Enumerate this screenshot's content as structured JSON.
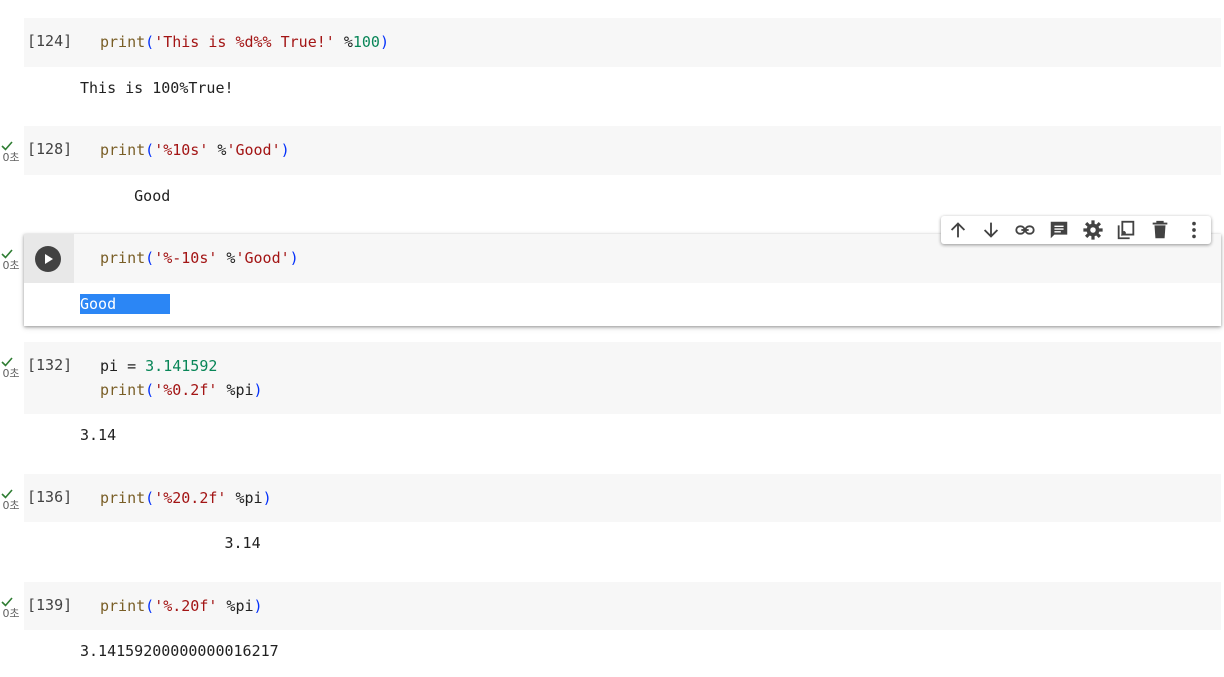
{
  "cells": [
    {
      "count": "[124]",
      "output": "This is 100%True!",
      "status": ""
    },
    {
      "count": "[128]",
      "output": "     Good",
      "status": "0초"
    },
    {
      "count": "",
      "output": "Good",
      "status": "0초"
    },
    {
      "count": "[132]",
      "output": "3.14",
      "status": "0초"
    },
    {
      "count": "[136]",
      "output": "                3.14",
      "status": "0초"
    },
    {
      "count": "[139]",
      "output": "3.14159200000000016217",
      "status": "0초"
    }
  ],
  "code": {
    "c124": {
      "fn": "print",
      "lp": "(",
      "str": "'This is %d%% True!'",
      "op": " %",
      "num": "100",
      "rp": ")"
    },
    "c128": {
      "fn": "print",
      "lp": "(",
      "str": "'%10s'",
      "op": " %",
      "str2": "'Good'",
      "rp": ")"
    },
    "csel": {
      "fn": "print",
      "lp": "(",
      "str": "'%-10s'",
      "op": " %",
      "str2": "'Good'",
      "rp": ")"
    },
    "c132a": {
      "var": "pi = ",
      "num": "3.141592"
    },
    "c132b": {
      "fn": "print",
      "lp": "(",
      "str": "'%0.2f'",
      "op": " %pi",
      "rp": ")"
    },
    "c136": {
      "fn": "print",
      "lp": "(",
      "str": "'%20.2f'",
      "op": " %pi",
      "rp": ")"
    },
    "c139": {
      "fn": "print",
      "lp": "(",
      "str": "'%.20f'",
      "op": " %pi",
      "rp": ")"
    }
  },
  "toolbar": [
    "arrow-up-icon",
    "arrow-down-icon",
    "link-icon",
    "comment-icon",
    "gear-icon",
    "mirror-cell-icon",
    "trash-icon",
    "more-vert-icon"
  ],
  "colors": {
    "keyword": "#795e26",
    "string": "#a31515",
    "number": "#098658",
    "paren": "#0431fa",
    "check": "#2e7d32",
    "selection": "#2b86f5"
  }
}
